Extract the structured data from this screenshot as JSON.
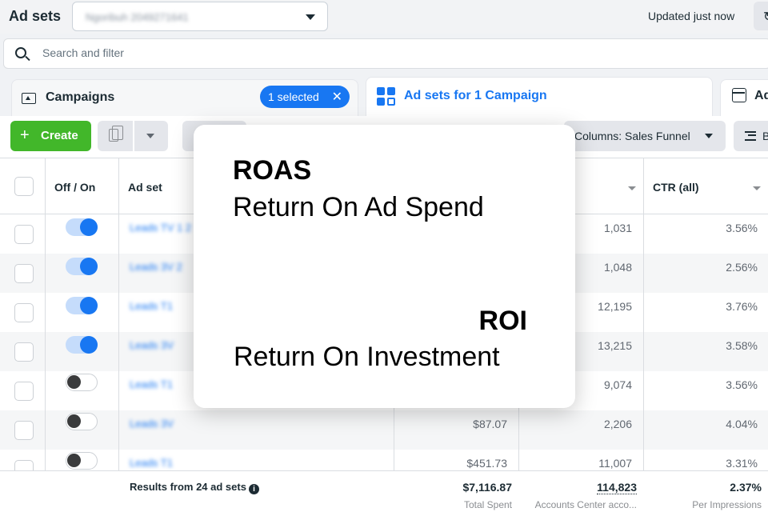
{
  "header": {
    "title": "Ad sets",
    "dropdown_value": "Ngoribuh 2049271641",
    "updated_text": "Updated just now"
  },
  "search": {
    "placeholder": "Search and filter"
  },
  "tabs": {
    "campaigns": {
      "label": "Campaigns",
      "selected_chip": "1 selected"
    },
    "adsets": {
      "label": "Ad sets for 1 Campaign"
    },
    "ads": {
      "label": "Ad"
    }
  },
  "toolbar": {
    "create_label": "Create",
    "columns_label": "Columns: Sales Funnel",
    "breakdown_label": "B"
  },
  "table": {
    "headers": {
      "toggle": "Off / On",
      "adset": "Ad set",
      "ctr": "CTR (all)"
    },
    "rows": [
      {
        "on": true,
        "name": "Leads TV 1 2",
        "amount": "",
        "reach": "1,031",
        "ctr": "3.56%"
      },
      {
        "on": true,
        "name": "Leads 3V 2",
        "amount": "",
        "reach": "1,048",
        "ctr": "2.56%"
      },
      {
        "on": true,
        "name": "Leads T1",
        "amount": "",
        "reach": "12,195",
        "ctr": "3.76%"
      },
      {
        "on": true,
        "name": "Leads 3V",
        "amount": "",
        "reach": "13,215",
        "ctr": "3.58%"
      },
      {
        "on": false,
        "name": "Leads T1",
        "amount": "",
        "reach": "9,074",
        "ctr": "3.56%"
      },
      {
        "on": false,
        "name": "Leads 3V",
        "amount": "$87.07",
        "reach": "2,206",
        "ctr": "4.04%"
      },
      {
        "on": false,
        "name": "Leads T1",
        "amount": "$451.73",
        "reach": "11,007",
        "ctr": "3.31%"
      }
    ],
    "footer": {
      "results": "Results from 24 ad sets",
      "spent_value": "$7,116.87",
      "spent_label": "Total Spent",
      "reach_value": "114,823",
      "reach_label": "Accounts Center acco...",
      "ctr_value": "2.37%",
      "ctr_label": "Per Impressions"
    }
  },
  "overlay": {
    "roas_title": "ROAS",
    "roas_sub": "Return On Ad Spend",
    "roi_title": "ROI",
    "roi_sub": "Return On Investment"
  }
}
